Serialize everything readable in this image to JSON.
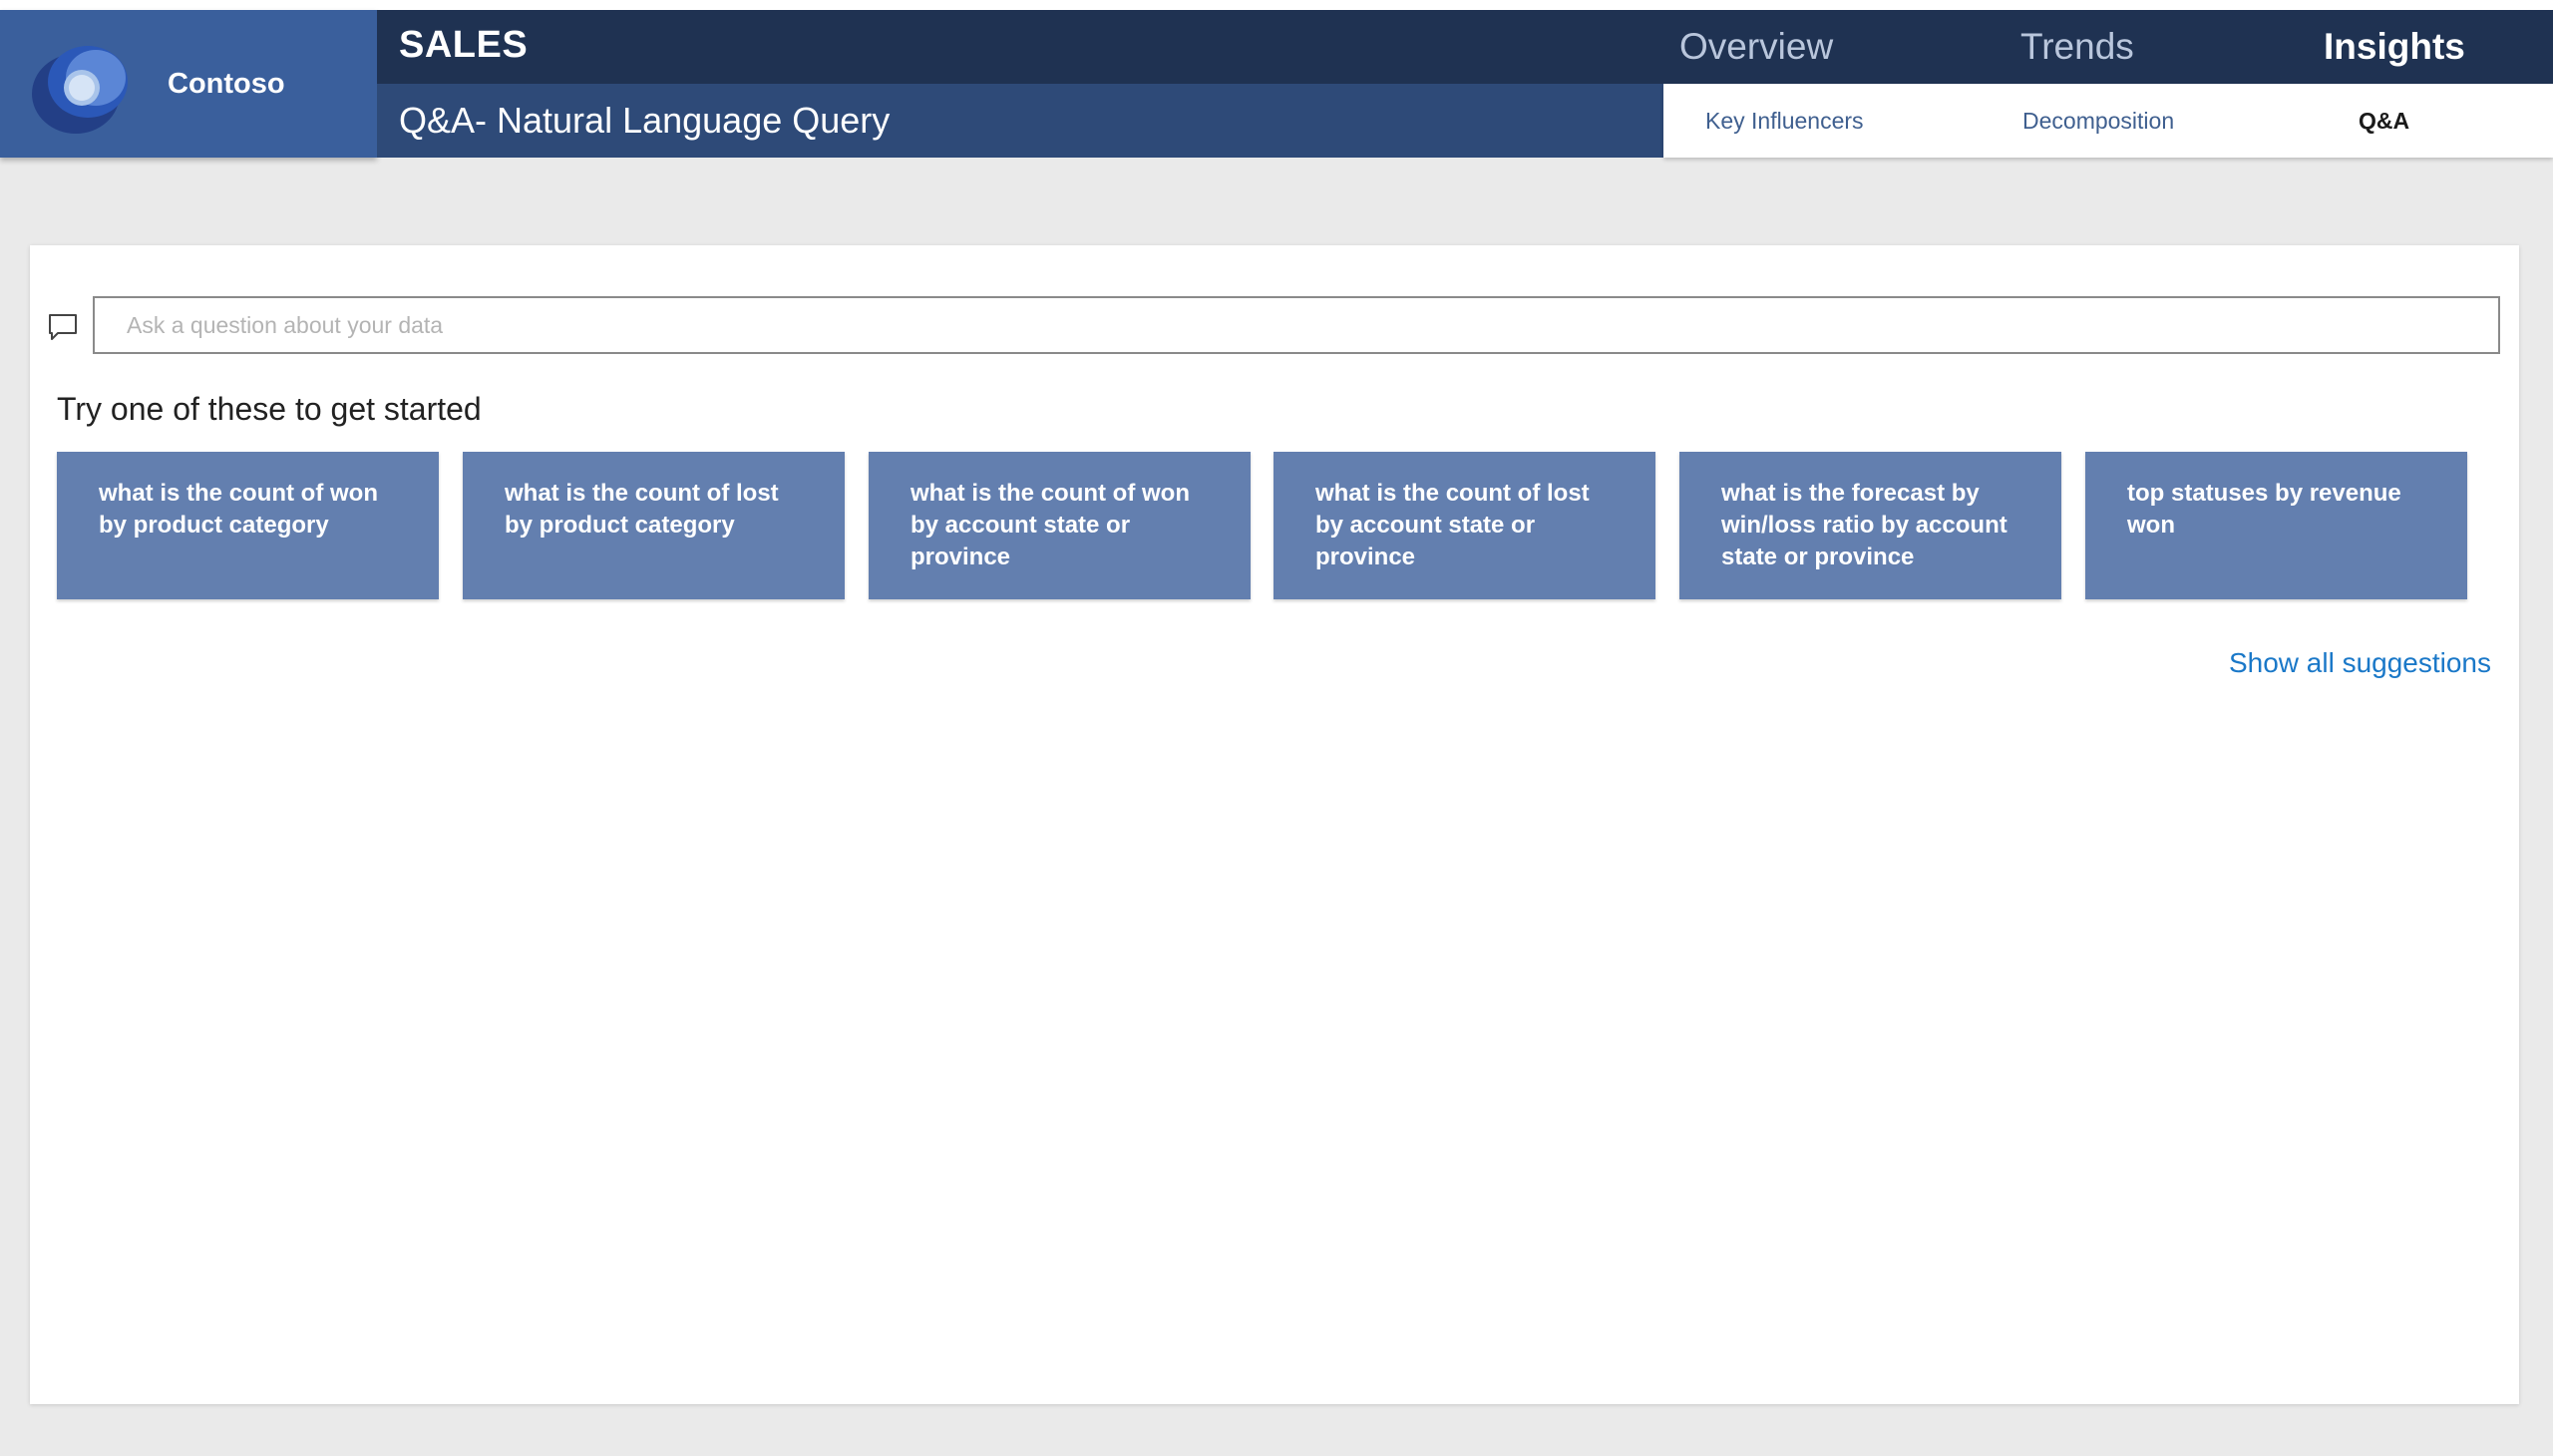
{
  "brand": {
    "name": "Contoso",
    "logo_icon": "contoso-logo-icon"
  },
  "header": {
    "report_title": "SALES",
    "page_title": "Q&A- Natural Language Query",
    "nav": [
      {
        "label": "Overview",
        "active": false
      },
      {
        "label": "Trends",
        "active": false
      },
      {
        "label": "Insights",
        "active": true
      }
    ],
    "subnav": [
      {
        "label": "Key Influencers",
        "active": false
      },
      {
        "label": "Decomposition",
        "active": false
      },
      {
        "label": "Q&A",
        "active": true
      }
    ]
  },
  "qa": {
    "input_icon": "chat-bubble-icon",
    "input_placeholder": "Ask a question about your data",
    "input_value": "",
    "heading": "Try one of these to get started",
    "suggestions": [
      "what is the count of won by product category",
      "what is the count of lost by product category",
      "what is the count of won by account state or province",
      "what is the count of lost by account state or province",
      "what is the forecast by win/loss ratio by account state or province",
      "top statuses by revenue won"
    ],
    "show_all_label": "Show all suggestions"
  },
  "colors": {
    "brand_bg": "#3a5f9c",
    "header_dark": "#1f3252",
    "header_mid": "#2e4a78",
    "suggestion_bg": "#637faf",
    "link": "#1a78c8",
    "canvas_bg": "#eaeaea"
  }
}
